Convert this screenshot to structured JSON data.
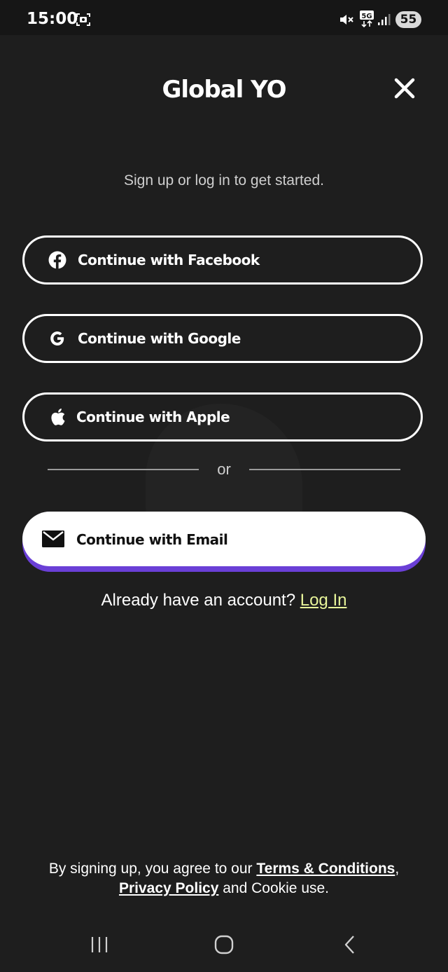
{
  "status_bar": {
    "time": "15:00",
    "battery": "55",
    "icons": [
      "screenshot-icon",
      "mute-icon",
      "5g-icon",
      "signal-icon"
    ]
  },
  "header": {
    "title": "Global YO",
    "close_icon": "close-icon"
  },
  "subtitle": "Sign up or log in to get started.",
  "auth_buttons": {
    "facebook": {
      "label": "Continue with Facebook",
      "icon": "facebook-icon"
    },
    "google": {
      "label": "Continue with Google",
      "icon": "google-icon"
    },
    "apple": {
      "label": "Continue with Apple",
      "icon": "apple-icon"
    }
  },
  "divider_text": "or",
  "email_button": {
    "label": "Continue with Email",
    "icon": "mail-icon"
  },
  "login": {
    "prompt": "Already have an account?",
    "link": "Log In"
  },
  "legal": {
    "prefix": "By signing up, you agree to our",
    "terms": "Terms & Conditions",
    "comma": ",",
    "privacy": "Privacy Policy",
    "suffix": "and Cookie use."
  },
  "nav_bar": [
    "recents-icon",
    "home-icon",
    "back-icon"
  ],
  "colors": {
    "background": "#1e1e1e",
    "accent_purple": "#6a3fd6",
    "link_yellow": "#e8f59a"
  }
}
